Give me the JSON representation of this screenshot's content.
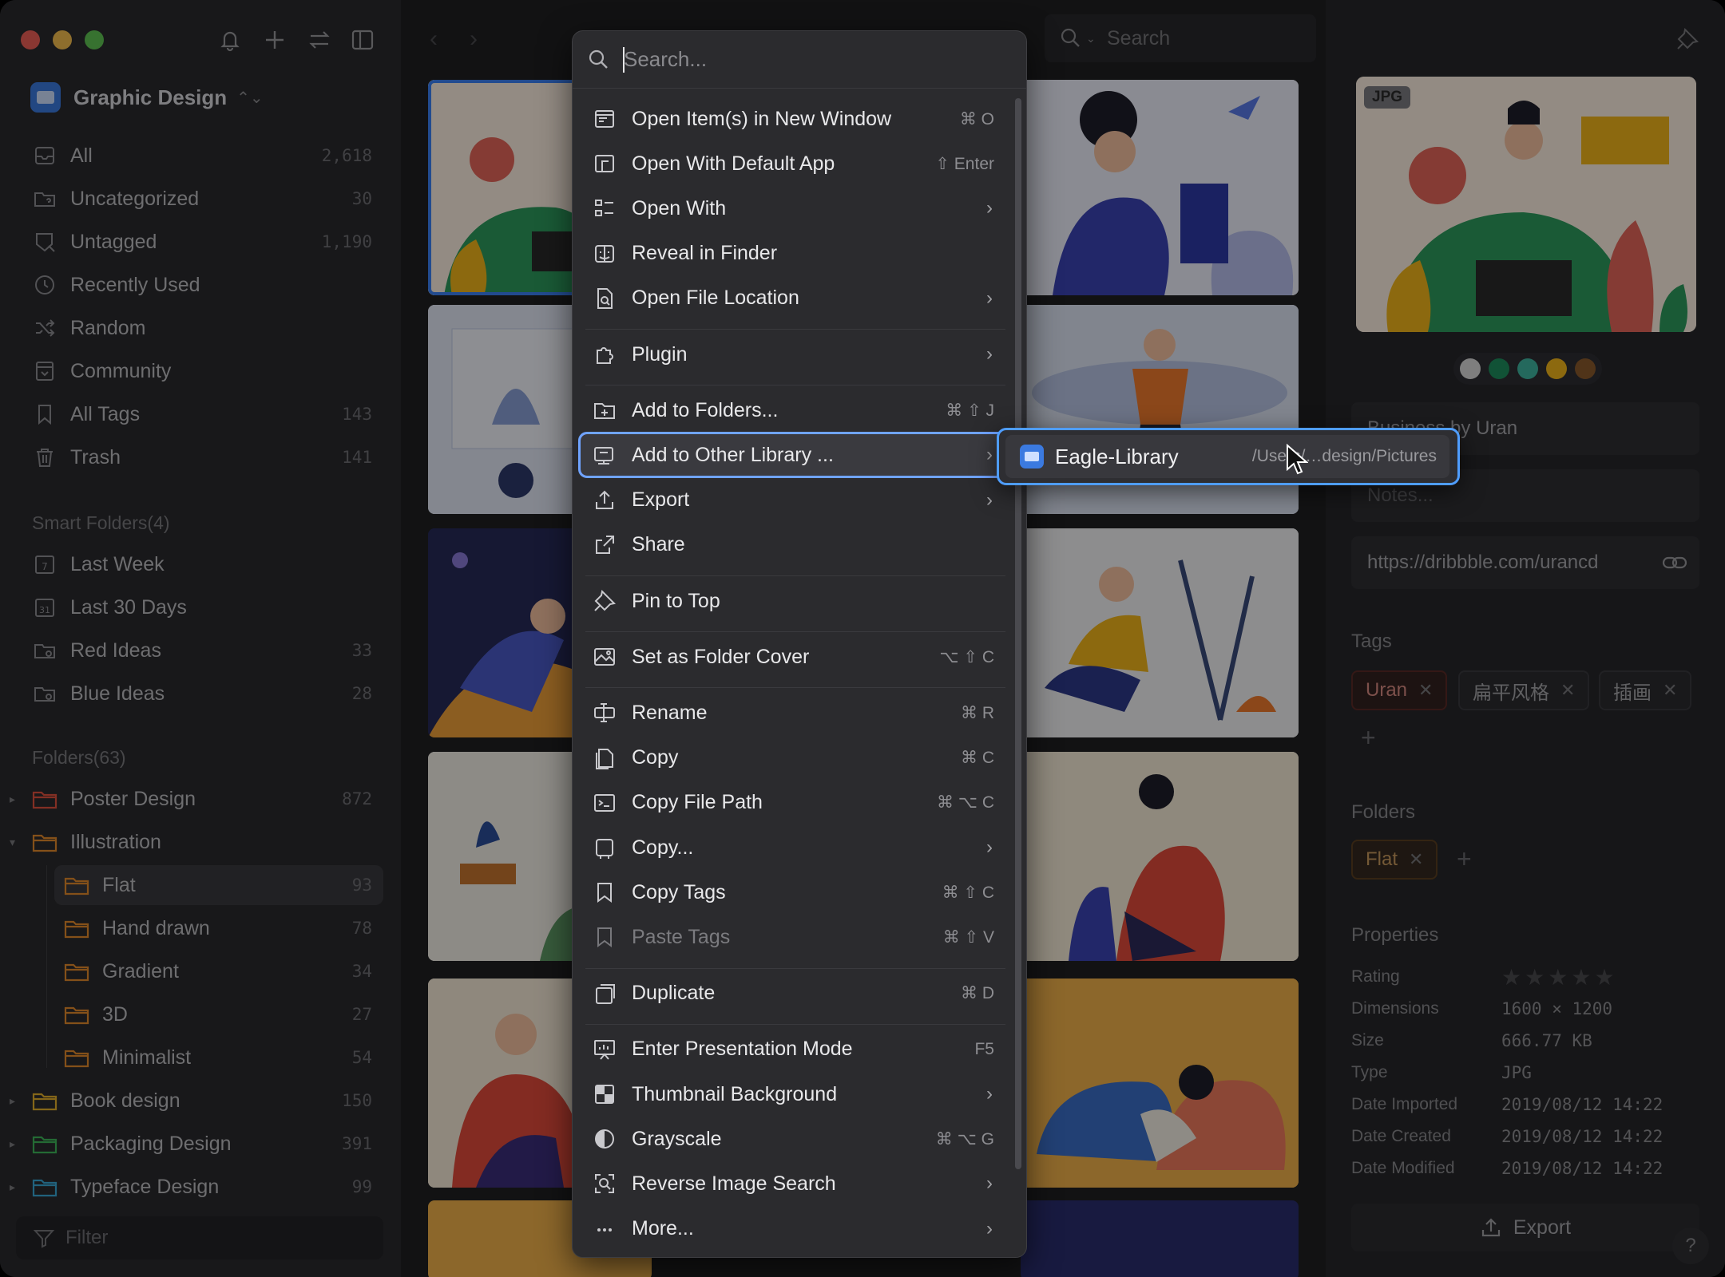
{
  "app": {
    "library_name": "Graphic Design"
  },
  "sidebar": {
    "nav": [
      {
        "label": "All",
        "count": "2,618",
        "icon": "inbox-icon"
      },
      {
        "label": "Uncategorized",
        "count": "30",
        "icon": "folder-question-icon"
      },
      {
        "label": "Untagged",
        "count": "1,190",
        "icon": "tag-off-icon"
      },
      {
        "label": "Recently Used",
        "count": "",
        "icon": "clock-icon"
      },
      {
        "label": "Random",
        "count": "",
        "icon": "shuffle-icon"
      },
      {
        "label": "Community",
        "count": "",
        "icon": "community-icon"
      },
      {
        "label": "All Tags",
        "count": "143",
        "icon": "bookmark-icon"
      },
      {
        "label": "Trash",
        "count": "141",
        "icon": "trash-icon"
      }
    ],
    "smart_title": "Smart Folders(4)",
    "smart": [
      {
        "label": "Last Week",
        "count": "",
        "icon": "calendar-7-icon"
      },
      {
        "label": "Last 30 Days",
        "count": "",
        "icon": "calendar-31-icon"
      },
      {
        "label": "Red Ideas",
        "count": "33",
        "icon": "smart-folder-icon"
      },
      {
        "label": "Blue Ideas",
        "count": "28",
        "icon": "smart-folder-icon"
      }
    ],
    "folders_title": "Folders(63)",
    "folders": [
      {
        "label": "Poster Design",
        "count": "872",
        "color": "#e0523f",
        "expanded": false
      },
      {
        "label": "Illustration",
        "count": "",
        "color": "#e48a2b",
        "expanded": true
      },
      {
        "label": "Flat",
        "count": "93",
        "color": "#e48a2b",
        "sub": true,
        "active": true
      },
      {
        "label": "Hand drawn",
        "count": "78",
        "color": "#e48a2b",
        "sub": true
      },
      {
        "label": "Gradient",
        "count": "34",
        "color": "#e48a2b",
        "sub": true
      },
      {
        "label": "3D",
        "count": "27",
        "color": "#e48a2b",
        "sub": true
      },
      {
        "label": "Minimalist",
        "count": "54",
        "color": "#e48a2b",
        "sub": true
      },
      {
        "label": "Book design",
        "count": "150",
        "color": "#e4b02b",
        "expanded": false
      },
      {
        "label": "Packaging Design",
        "count": "391",
        "color": "#3fb75a",
        "expanded": false
      },
      {
        "label": "Typeface Design",
        "count": "99",
        "color": "#3aa9d8",
        "expanded": false
      }
    ],
    "filter_placeholder": "Filter"
  },
  "toolbar": {
    "search_placeholder": "Search"
  },
  "context_menu": {
    "search_placeholder": "Search...",
    "items": [
      {
        "label": "Open Item(s) in New Window",
        "shortcut": "⌘ O",
        "icon": "window-icon"
      },
      {
        "label": "Open With Default App",
        "shortcut": "⇧ Enter",
        "icon": "open-app-icon"
      },
      {
        "label": "Open With",
        "submenu": true,
        "icon": "grid-list-icon"
      },
      {
        "label": "Reveal in Finder",
        "icon": "finder-icon"
      },
      {
        "label": "Open File Location",
        "submenu": true,
        "icon": "file-search-icon"
      },
      {
        "sep": true
      },
      {
        "label": "Plugin",
        "submenu": true,
        "icon": "puzzle-icon"
      },
      {
        "sep": true
      },
      {
        "label": "Add to Folders...",
        "shortcut": "⌘ ⇧ J",
        "icon": "folder-add-icon"
      },
      {
        "label": "Add to Other Library ...",
        "submenu": true,
        "icon": "library-add-icon",
        "highlight": true
      },
      {
        "label": "Export",
        "submenu": true,
        "icon": "export-icon"
      },
      {
        "label": "Share",
        "icon": "share-icon"
      },
      {
        "sep": true
      },
      {
        "label": "Pin to Top",
        "icon": "pin-icon"
      },
      {
        "sep": true
      },
      {
        "label": "Set as Folder Cover",
        "shortcut": "⌥ ⇧ C",
        "icon": "image-cover-icon"
      },
      {
        "sep": true
      },
      {
        "label": "Rename",
        "shortcut": "⌘ R",
        "icon": "rename-icon"
      },
      {
        "label": "Copy",
        "shortcut": "⌘ C",
        "icon": "copy-icon"
      },
      {
        "label": "Copy File Path",
        "shortcut": "⌘ ⌥ C",
        "icon": "terminal-icon"
      },
      {
        "label": "Copy...",
        "submenu": true,
        "icon": "copy-more-icon"
      },
      {
        "label": "Copy Tags",
        "shortcut": "⌘ ⇧ C",
        "icon": "tag-copy-icon"
      },
      {
        "label": "Paste Tags",
        "shortcut": "⌘ ⇧ V",
        "icon": "tag-paste-icon",
        "disabled": true
      },
      {
        "sep": true
      },
      {
        "label": "Duplicate",
        "shortcut": "⌘ D",
        "icon": "duplicate-icon"
      },
      {
        "sep": true
      },
      {
        "label": "Enter Presentation Mode",
        "shortcut": "F5",
        "icon": "presentation-icon"
      },
      {
        "label": "Thumbnail Background",
        "submenu": true,
        "icon": "checker-icon"
      },
      {
        "label": "Grayscale",
        "shortcut": "⌘ ⌥ G",
        "icon": "grayscale-icon"
      },
      {
        "label": "Reverse Image Search",
        "submenu": true,
        "icon": "image-search-icon"
      },
      {
        "label": "More...",
        "submenu": true,
        "icon": "ellipsis-icon"
      }
    ]
  },
  "submenu": {
    "library_name": "Eagle-Library",
    "path": "/Users/…design/Pictures"
  },
  "inspector": {
    "file_badge": "JPG",
    "palette": [
      "#d9d9d9",
      "#1e8e5e",
      "#3fb5a0",
      "#f2b61a",
      "#8a5a2b"
    ],
    "name": "Business by Uran",
    "notes_placeholder": "Notes...",
    "url": "https://dribbble.com/urancd",
    "tags_title": "Tags",
    "tags": [
      {
        "label": "Uran",
        "accent": true
      },
      {
        "label": "扁平风格"
      },
      {
        "label": "插画"
      }
    ],
    "folders_title": "Folders",
    "folder_chip": "Flat",
    "properties_title": "Properties",
    "rating_label": "Rating",
    "rating_value": 0,
    "properties": [
      {
        "k": "Dimensions",
        "v": "1600 × 1200"
      },
      {
        "k": "Size",
        "v": "666.77 KB"
      },
      {
        "k": "Type",
        "v": "JPG"
      },
      {
        "k": "Date Imported",
        "v": "2019/08/12 14:22"
      },
      {
        "k": "Date Created",
        "v": "2019/08/12 14:22"
      },
      {
        "k": "Date Modified",
        "v": "2019/08/12 14:22"
      }
    ],
    "export_label": "Export",
    "help_label": "?"
  }
}
